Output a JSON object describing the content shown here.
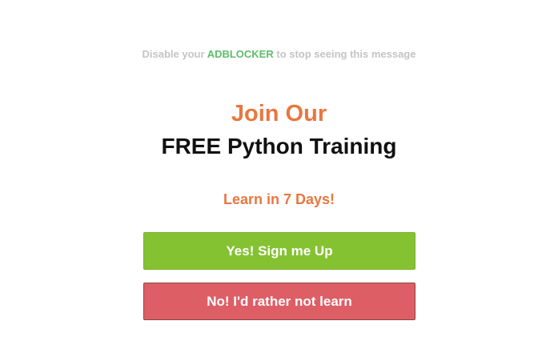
{
  "notice": {
    "prefix": "Disable your ",
    "highlight": "ADBLOCKER",
    "suffix": " to stop seeing this message"
  },
  "heading": {
    "line1": "Join Our",
    "line2": "FREE Python Training"
  },
  "subheading": "Learn in 7 Days!",
  "buttons": {
    "accept_label": "Yes! Sign me Up",
    "decline_label": "No! I'd rather not learn"
  },
  "colors": {
    "accent_orange": "#e8773f",
    "highlight_green": "#5cbd6a",
    "accept_green": "#85c232",
    "decline_red": "#de5e66"
  }
}
